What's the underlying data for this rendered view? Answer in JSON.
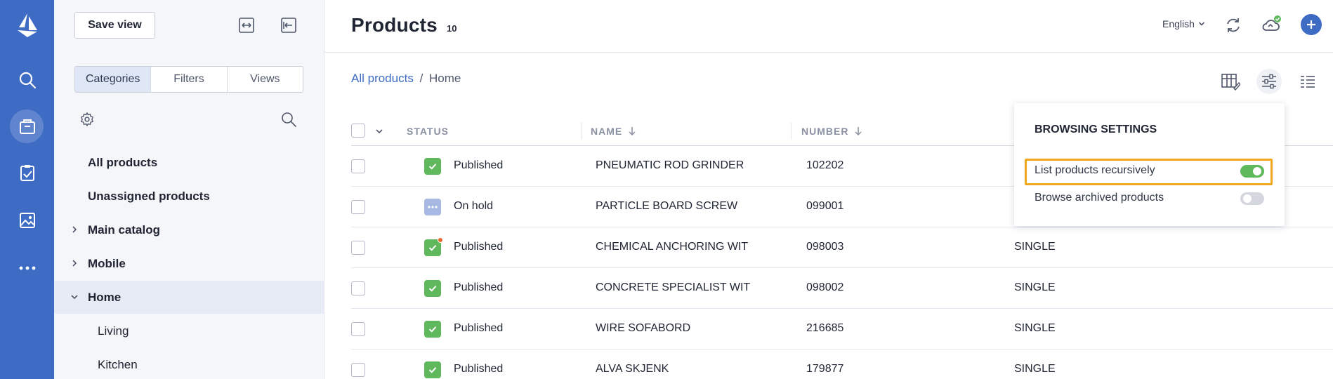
{
  "rail": {
    "icons": [
      "logo-icon",
      "search-icon",
      "products-icon",
      "tasks-icon",
      "images-icon",
      "more-icon"
    ]
  },
  "panel": {
    "save_view": "Save view",
    "tabs": [
      "Categories",
      "Filters",
      "Views"
    ],
    "active_tab": "Categories",
    "tree": [
      {
        "label": "All products",
        "bold": true,
        "chevron": "none"
      },
      {
        "label": "Unassigned products",
        "bold": true,
        "chevron": "none"
      },
      {
        "label": "Main catalog",
        "bold": true,
        "chevron": "right"
      },
      {
        "label": "Mobile",
        "bold": true,
        "chevron": "right"
      },
      {
        "label": "Home",
        "bold": true,
        "chevron": "down",
        "selected": true
      },
      {
        "label": "Living",
        "bold": false,
        "chevron": "none"
      },
      {
        "label": "Kitchen",
        "bold": false,
        "chevron": "none"
      }
    ]
  },
  "header": {
    "title": "Products",
    "count": "10",
    "language": "English"
  },
  "breadcrumb": {
    "root": "All products",
    "separator": "/",
    "current": "Home"
  },
  "table": {
    "columns": {
      "status": "STATUS",
      "name": "NAME",
      "number": "NUMBER"
    },
    "rows": [
      {
        "status": "Published",
        "status_type": "published",
        "name": "PNEUMATIC ROD GRINDER",
        "number": "102202",
        "type": ""
      },
      {
        "status": "On hold",
        "status_type": "on-hold",
        "name": "PARTICLE BOARD SCREW",
        "number": "099001",
        "type": ""
      },
      {
        "status": "Published",
        "status_type": "published-alert",
        "name": "CHEMICAL ANCHORING WIT",
        "number": "098003",
        "type": "SINGLE"
      },
      {
        "status": "Published",
        "status_type": "published",
        "name": "CONCRETE SPECIALIST WIT",
        "number": "098002",
        "type": "SINGLE"
      },
      {
        "status": "Published",
        "status_type": "published",
        "name": "WIRE SOFABORD",
        "number": "216685",
        "type": "SINGLE"
      },
      {
        "status": "Published",
        "status_type": "published",
        "name": "ALVA SKJENK",
        "number": "179877",
        "type": "SINGLE"
      }
    ]
  },
  "browsing_settings": {
    "title": "BROWSING SETTINGS",
    "options": [
      {
        "label": "List products recursively",
        "enabled": true
      },
      {
        "label": "Browse archived products",
        "enabled": false
      }
    ]
  },
  "colors": {
    "rail": "#3e6bc4",
    "published": "#5fb85c",
    "on_hold": "#a7b8e3",
    "highlight": "#f0a91c",
    "link": "#3e6bc4"
  }
}
